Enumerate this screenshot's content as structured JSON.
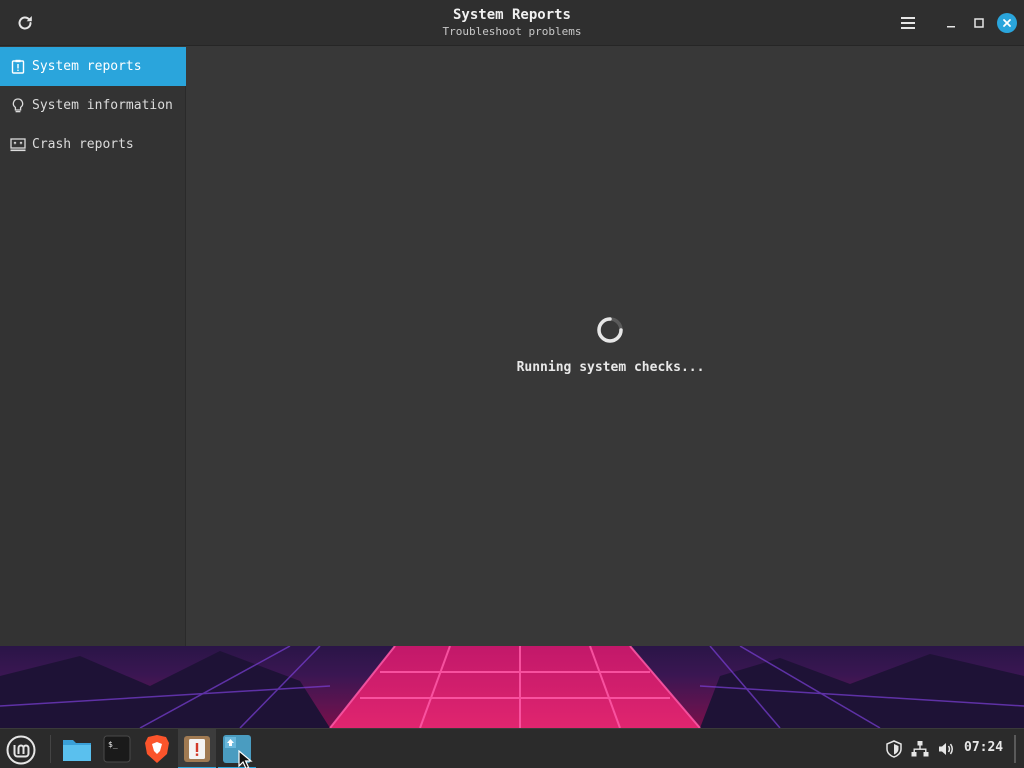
{
  "window": {
    "title": "System Reports",
    "subtitle": "Troubleshoot problems",
    "accent_color": "#2aa5dc",
    "controls": {
      "refresh_icon": "refresh-icon",
      "menu_icon": "hamburger-menu-icon",
      "minimize_icon": "minimize-icon",
      "maximize_icon": "maximize-icon",
      "close_icon": "close-icon"
    }
  },
  "sidebar": {
    "items": [
      {
        "label": "System reports",
        "icon": "clipboard-alert-icon",
        "active": true
      },
      {
        "label": "System information",
        "icon": "lightbulb-icon",
        "active": false
      },
      {
        "label": "Crash reports",
        "icon": "monitor-crash-icon",
        "active": false
      }
    ]
  },
  "main": {
    "status_text": "Running system checks...",
    "spinner_icon": "loading-spinner-icon"
  },
  "taskbar": {
    "start_icon": "linux-mint-menu-icon",
    "apps": [
      {
        "name": "Files",
        "icon": "folder-icon"
      },
      {
        "name": "Terminal",
        "icon": "terminal-icon"
      },
      {
        "name": "Brave",
        "icon": "brave-browser-icon"
      },
      {
        "name": "System Reports",
        "icon": "system-reports-icon"
      },
      {
        "name": "Update Manager",
        "icon": "update-manager-icon"
      }
    ],
    "tray": {
      "shield_icon": "shield-icon",
      "network_icon": "network-icon",
      "volume_icon": "volume-icon",
      "clock": "07:24"
    }
  }
}
